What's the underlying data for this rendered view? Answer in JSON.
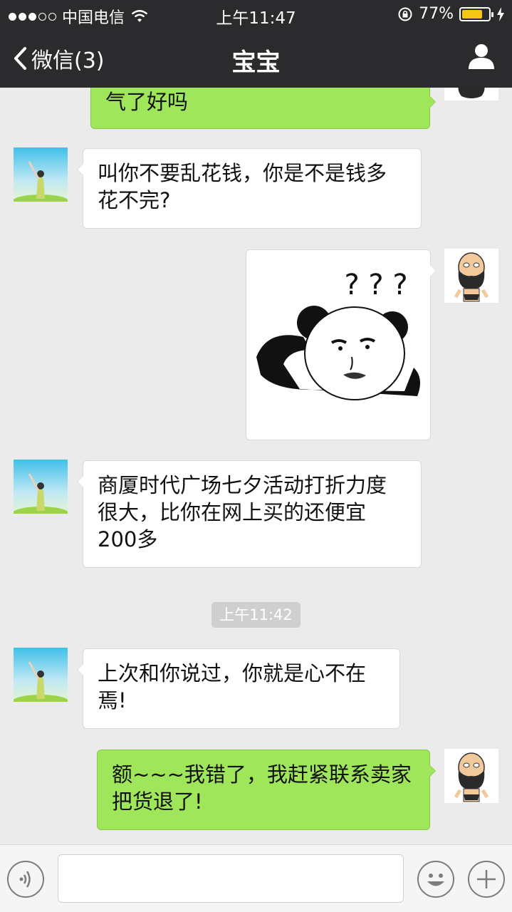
{
  "status_bar": {
    "carrier": "中国电信",
    "time": "上午11:47",
    "battery_percent": "77%",
    "battery_level": 0.77,
    "signal_bars_filled": 3,
    "signal_bars_total": 5
  },
  "nav": {
    "back_label": "微信(3)",
    "title": "宝宝"
  },
  "messages": [
    {
      "side": "right",
      "text": "气了好吗"
    },
    {
      "side": "left",
      "lines": [
        "叫你不要乱花钱，你是不是钱多",
        "花不完?"
      ]
    },
    {
      "side": "right",
      "type": "sticker",
      "sticker_text": "? ? ?"
    },
    {
      "side": "left",
      "lines": [
        "商厦时代广场七夕活动打折力度",
        "很大，比你在网上买的还便宜",
        "200多"
      ]
    },
    {
      "side": "left",
      "lines": [
        "上次和你说过，你就是心不在",
        "焉!"
      ]
    },
    {
      "side": "right",
      "lines": [
        "额~~~我错了，我赶紧联系卖家",
        "把货退了!"
      ]
    }
  ],
  "timestamp": "上午11:42",
  "input": {
    "placeholder": ""
  },
  "colors": {
    "header_bg": "#2b2b2d",
    "chat_bg": "#ebebeb",
    "sent_bubble": "#9fe65a",
    "received_bubble": "#ffffff",
    "battery_fill": "#f5c518"
  },
  "icons": {
    "back": "chevron-left-icon",
    "profile": "person-icon",
    "voice": "voice-icon",
    "emoji": "emoji-icon",
    "plus": "plus-icon",
    "wifi": "wifi-icon",
    "lock": "orientation-lock-icon",
    "charging": "charging-bolt-icon"
  }
}
